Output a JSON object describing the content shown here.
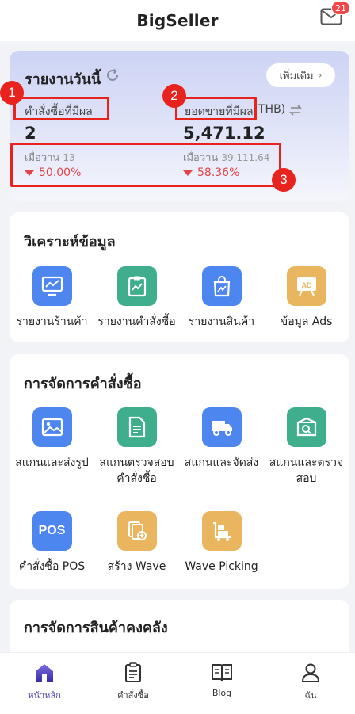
{
  "header": {
    "title": "BigSeller",
    "mail_badge": "21"
  },
  "report": {
    "title": "รายงานวันนี้",
    "more_label": "เพิ่มเติม",
    "orders_label": "คำสั่งซื้อที่มีผล",
    "orders_value": "2",
    "sales_label": "ยอดขายที่มีผล",
    "sales_unit": "THB)",
    "sales_value": "5,471.12",
    "yesterday_label": "เมื่อวาน",
    "orders_yesterday": "13",
    "sales_yesterday": "39,111.64",
    "orders_change": "50.00%",
    "sales_change": "58.36%"
  },
  "annotations": [
    "1",
    "2",
    "3"
  ],
  "analysis": {
    "title": "วิเคราะห์ข้อมูล",
    "items": [
      {
        "label": "รายงานร้านค้า"
      },
      {
        "label": "รายงานคำสั่งซื้อ"
      },
      {
        "label": "รายงานสินค้า"
      },
      {
        "label": "ข้อมูล Ads"
      }
    ]
  },
  "orders": {
    "title": "การจัดการคำสั่งซื้อ",
    "items": [
      {
        "label": "สแกนและส่งรูป"
      },
      {
        "label": "สแกนตรวจสอบคำสั่งซื้อ"
      },
      {
        "label": "สแกนและจัดส่ง"
      },
      {
        "label": "สแกนและตรวจสอบ"
      },
      {
        "label": "คำสั่งซื้อ POS"
      },
      {
        "label": "สร้าง Wave"
      },
      {
        "label": "Wave Picking"
      }
    ],
    "pos_icon_text": "POS",
    "ads_icon_text": "AD"
  },
  "inventory": {
    "title": "การจัดการสินค้าคงคลัง"
  },
  "tabs": [
    {
      "label": "หน้าหลัก"
    },
    {
      "label": "คำสั่งซื้อ"
    },
    {
      "label": "Blog"
    },
    {
      "label": "ฉัน"
    }
  ],
  "colors": {
    "accent": "#4a3fb8",
    "highlight": "#e8221d",
    "decline": "#e0454a"
  }
}
